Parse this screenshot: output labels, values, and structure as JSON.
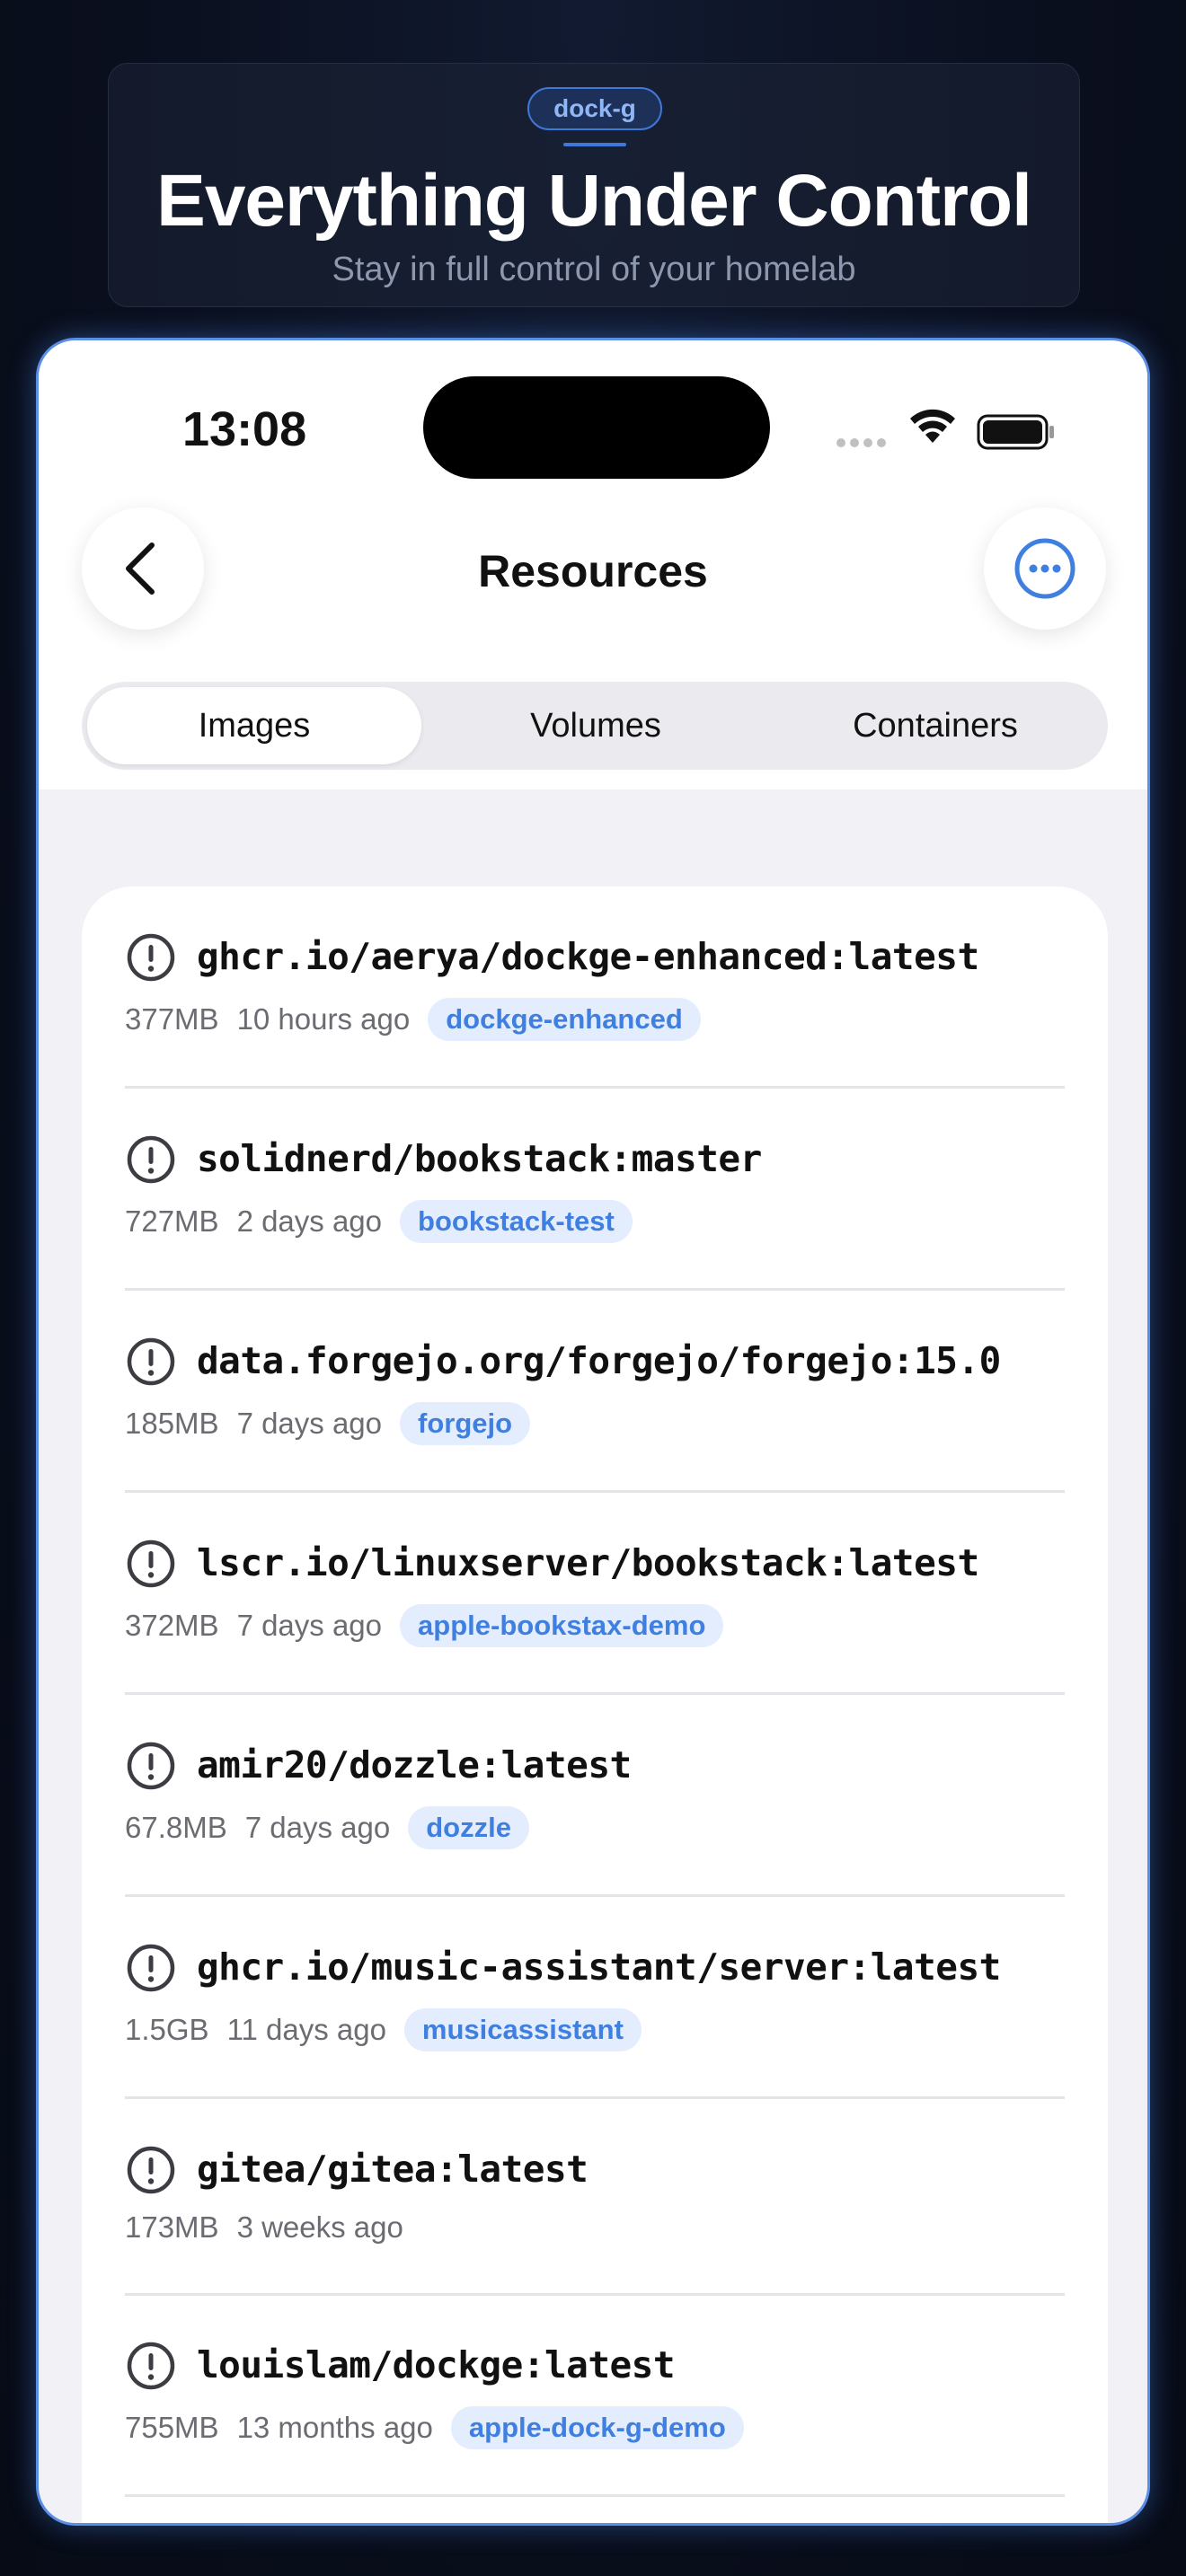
{
  "banner": {
    "badge": "dock-g",
    "title": "Everything Under Control",
    "subtitle": "Stay in full control of your homelab"
  },
  "status_bar": {
    "time": "13:08"
  },
  "nav": {
    "back_icon": "chevron-left-icon",
    "title": "Resources",
    "more_icon": "ellipsis-circle-icon"
  },
  "segments": [
    {
      "label": "Images",
      "active": true
    },
    {
      "label": "Volumes",
      "active": false
    },
    {
      "label": "Containers",
      "active": false
    }
  ],
  "images": [
    {
      "name": "ghcr.io/aerya/dockge-enhanced:latest",
      "size": "377MB",
      "age": "10 hours ago",
      "tag": "dockge-enhanced"
    },
    {
      "name": "solidnerd/bookstack:master",
      "size": "727MB",
      "age": "2 days ago",
      "tag": "bookstack-test"
    },
    {
      "name": "data.forgejo.org/forgejo/forgejo:15.0",
      "size": "185MB",
      "age": "7 days ago",
      "tag": "forgejo"
    },
    {
      "name": "lscr.io/linuxserver/bookstack:latest",
      "size": "372MB",
      "age": "7 days ago",
      "tag": "apple-bookstax-demo"
    },
    {
      "name": "amir20/dozzle:latest",
      "size": "67.8MB",
      "age": "7 days ago",
      "tag": "dozzle"
    },
    {
      "name": "ghcr.io/music-assistant/server:latest",
      "size": "1.5GB",
      "age": "11 days ago",
      "tag": "musicassistant"
    },
    {
      "name": "gitea/gitea:latest",
      "size": "173MB",
      "age": "3 weeks ago",
      "tag": ""
    },
    {
      "name": "louislam/dockge:latest",
      "size": "755MB",
      "age": "13 months ago",
      "tag": "apple-dock-g-demo"
    }
  ],
  "colors": {
    "accent": "#3f7fe0",
    "tag_bg": "#e3edfd",
    "icon_gray": "#3c3c43"
  }
}
